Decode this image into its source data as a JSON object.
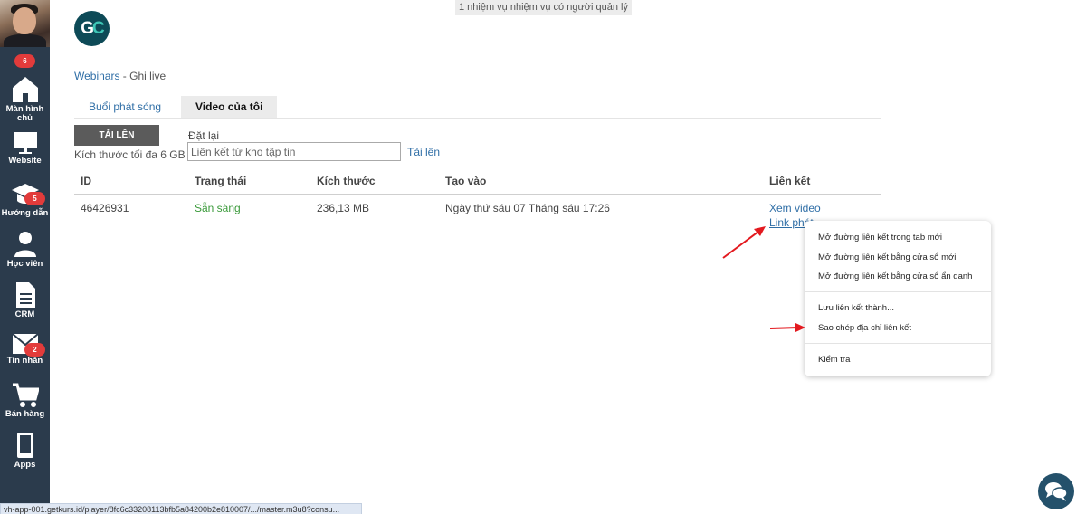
{
  "top_notice": "1 nhiệm vụ nhiệm vụ có người quản lý",
  "logo": {
    "g": "G",
    "c": "C"
  },
  "sidebar": {
    "avatar_badge": "6",
    "items": [
      {
        "label": "Màn hình chủ",
        "icon": "home-icon"
      },
      {
        "label": "Website",
        "icon": "monitor-icon"
      },
      {
        "label": "Hướng dẫn",
        "icon": "graduation-cap-icon",
        "badge": "5"
      },
      {
        "label": "Học viên",
        "icon": "user-icon"
      },
      {
        "label": "CRM",
        "icon": "document-icon"
      },
      {
        "label": "Tin nhắn",
        "icon": "mail-icon",
        "badge": "2"
      },
      {
        "label": "Bán hàng",
        "icon": "cart-icon"
      },
      {
        "label": "Apps",
        "icon": "phone-icon"
      }
    ]
  },
  "breadcrumb": {
    "root": "Webinars",
    "separator": " - ",
    "current": "Ghi live"
  },
  "tabs": [
    {
      "label": "Buổi phát sóng",
      "active": false
    },
    {
      "label": "Video của tôi",
      "active": true
    }
  ],
  "upload": {
    "button_label": "TẢI LÊN",
    "max_size": "Kích thước tối đa 6 GB",
    "reset_label": "Đặt lại",
    "input_placeholder": "Liên kết từ kho tập tin",
    "upload_link": "Tải lên"
  },
  "table": {
    "columns": [
      "ID",
      "Trạng thái",
      "Kích thước",
      "Tạo vào",
      "Liên kết"
    ],
    "rows": [
      {
        "id": "46426931",
        "status": "Sẵn sàng",
        "size": "236,13 MB",
        "created": "Ngày thứ sáu 07 Tháng sáu 17:26",
        "link_view": "Xem video",
        "link_play": "Link phát"
      }
    ]
  },
  "context_menu": {
    "items": [
      "Mở đường liên kết trong tab mới",
      "Mở đường liên kết bằng cửa sổ mới",
      "Mở đường liên kết bằng cửa sổ ẩn danh",
      "Lưu liên kết thành...",
      "Sao chép địa chỉ liên kết",
      "Kiểm tra"
    ]
  },
  "status_bar": "vh-app-001.getkurs.id/player/8fc6c33208113bfb5a84200b2e810007/.../master.m3u8?consu...",
  "colors": {
    "sidebar_bg": "#2b3b4c",
    "link": "#2f6ea6",
    "status_ready": "#3a9a3a",
    "badge": "#e23b3b",
    "arrow": "#e3191f",
    "chat_bubble": "#24516b"
  }
}
